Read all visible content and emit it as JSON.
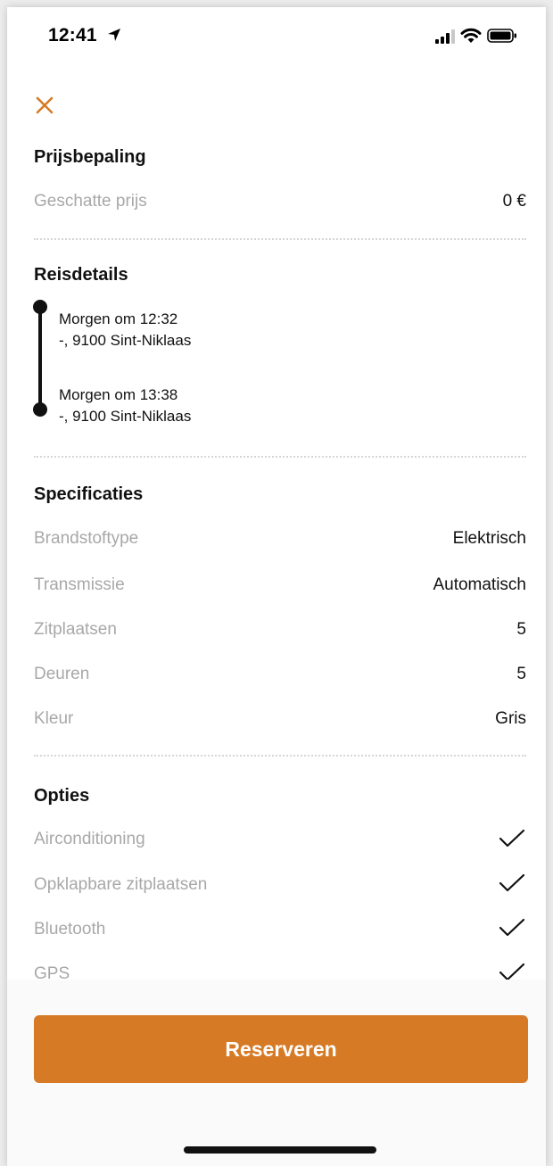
{
  "status_bar": {
    "time": "12:41"
  },
  "price": {
    "title": "Prijsbepaling",
    "label": "Geschatte prijs",
    "value": "0 €"
  },
  "trip": {
    "title": "Reisdetails",
    "start": {
      "time": "Morgen om 12:32",
      "address": "-, 9100 Sint-Niklaas"
    },
    "end": {
      "time": "Morgen om 13:38",
      "address": "-, 9100 Sint-Niklaas"
    }
  },
  "specs": {
    "title": "Specificaties",
    "rows": [
      {
        "label": "Brandstoftype",
        "value": "Elektrisch"
      },
      {
        "label": "Transmissie",
        "value": "Automatisch"
      },
      {
        "label": "Zitplaatsen",
        "value": "5"
      },
      {
        "label": "Deuren",
        "value": "5"
      },
      {
        "label": "Kleur",
        "value": "Gris"
      }
    ]
  },
  "options": {
    "title": "Opties",
    "items": [
      {
        "label": "Airconditioning",
        "checked": true
      },
      {
        "label": "Opklapbare zitplaatsen",
        "checked": true
      },
      {
        "label": "Bluetooth",
        "checked": true
      },
      {
        "label": "GPS",
        "checked": true
      }
    ]
  },
  "actions": {
    "reserve_label": "Reserveren"
  },
  "colors": {
    "accent": "#d67a25",
    "label_gray": "#a8a8a8",
    "text": "#111111"
  },
  "icons": {
    "close": "close-icon",
    "location": "location-arrow-icon",
    "signal": "signal-icon",
    "wifi": "wifi-icon",
    "battery": "battery-icon",
    "check": "check-icon"
  }
}
